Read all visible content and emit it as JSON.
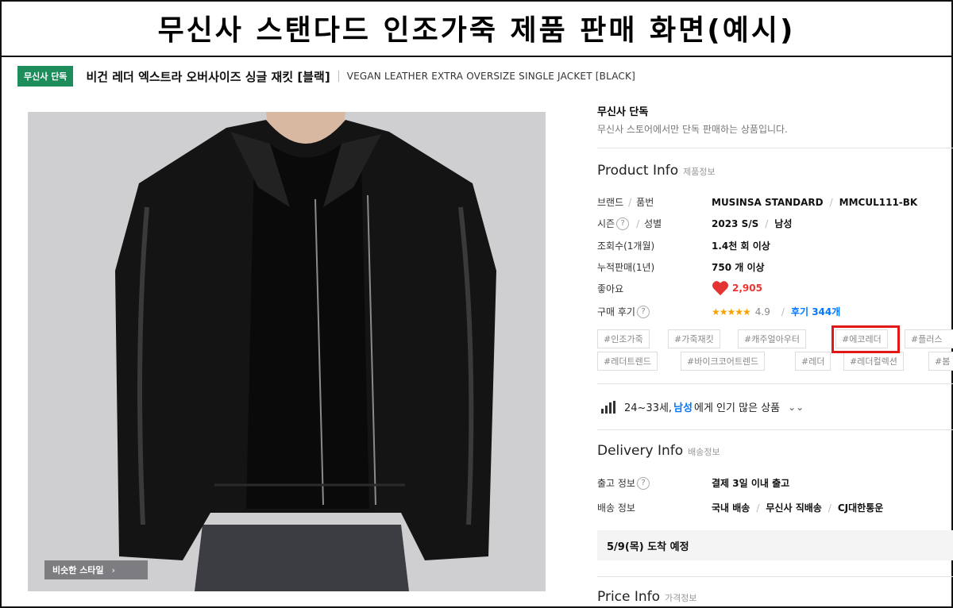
{
  "page_title": "무신사 스탠다드 인조가죽 제품 판매 화면(예시)",
  "product": {
    "exclusive_badge": "무신사 단독",
    "name_kr": "비건 레더 엑스트라 오버사이즈 싱글 재킷 [블랙]",
    "name_en": "VEGAN LEATHER EXTRA OVERSIZE SINGLE JACKET [BLACK]"
  },
  "image": {
    "similar_style_button": "비슷한 스타일",
    "colors": {
      "background": "#cfcfd1",
      "jacket": "#141414"
    }
  },
  "exclusive": {
    "title": "무신사 단독",
    "description": "무신사 스토어에서만 단독 판매하는 상품입니다."
  },
  "product_info": {
    "title": "Product Info",
    "subtitle": "제품정보",
    "rows": {
      "brand": {
        "label_a": "브랜드",
        "label_b": "품번",
        "value_a": "MUSINSA STANDARD",
        "value_b": "MMCUL111-BK"
      },
      "season": {
        "label_a": "시즌",
        "label_b": "성별",
        "value_a": "2023 S/S",
        "value_b": "남성"
      },
      "views": {
        "label": "조회수(1개월)",
        "value": "1.4천 회 이상"
      },
      "sales": {
        "label": "누적판매(1년)",
        "value": "750 개 이상"
      },
      "likes": {
        "label": "좋아요",
        "value": "2,905"
      },
      "reviews": {
        "label": "구매 후기",
        "stars": "★★★★★",
        "rating": "4.9",
        "link": "후기 344개"
      }
    },
    "help_icon_text": "?"
  },
  "tags": [
    "#인조가죽",
    "#가죽재킷",
    "#캐주얼아우터",
    "#에코레더",
    "#플러스",
    "#레더트렌드",
    "#바이크코어트렌드",
    "#레더",
    "#레더컬렉션",
    "#봄"
  ],
  "highlighted_tag": "#에코레더",
  "popular": {
    "age": "24~33세,",
    "gender": "남성",
    "suffix": "에게 인기 많은 상품"
  },
  "delivery_info": {
    "title": "Delivery Info",
    "subtitle": "배송정보",
    "ship_label": "출고 정보",
    "ship_value": "결제 3일 이내 출고",
    "method_label": "배송 정보",
    "method_values": [
      "국내 배송",
      "무신사 직배송",
      "CJ대한통운"
    ],
    "arrival": "5/9(목) 도착 예정"
  },
  "price_info": {
    "title": "Price Info",
    "subtitle": "가격정보"
  },
  "accent_colors": {
    "badge_green": "#1d8d5b",
    "link_blue": "#0078ff",
    "like_red": "#e33333",
    "star_orange": "#f5a300",
    "highlight_red": "#e01818"
  }
}
